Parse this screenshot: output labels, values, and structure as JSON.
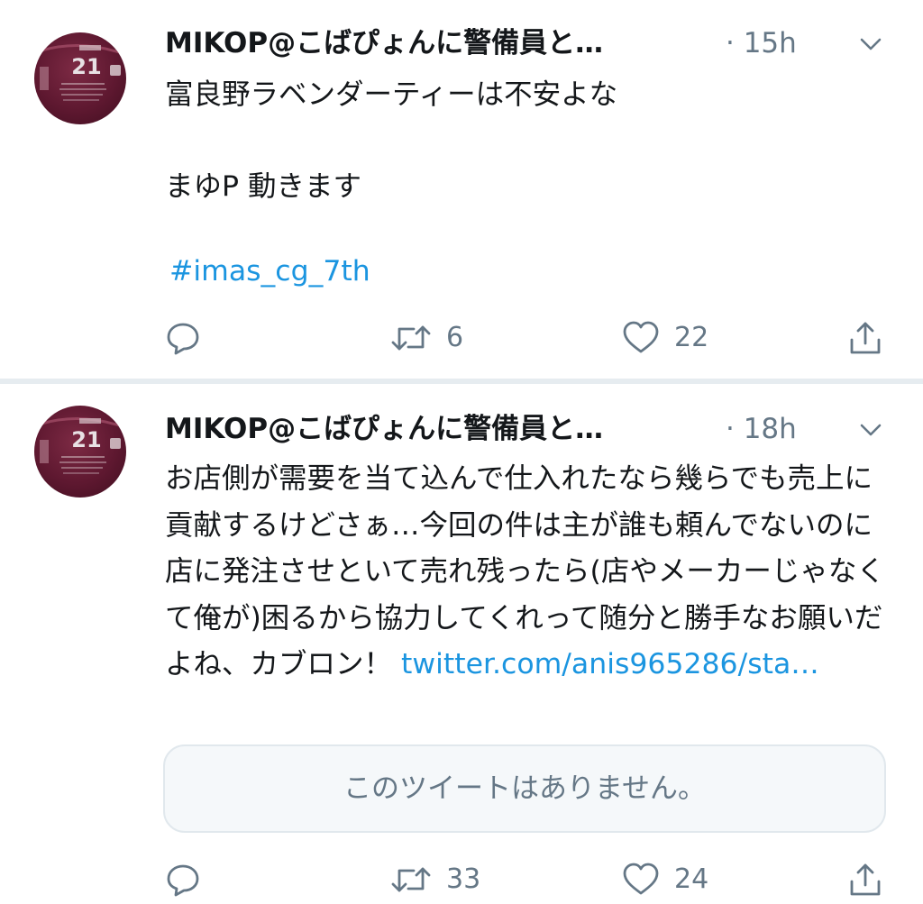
{
  "tweets": [
    {
      "author": "MIKOP@こばぴょんに警備員と…",
      "time": "· 15h",
      "avatar_number": "21",
      "text": "富良野ラベンダーティーは不安よな\n\nまゆP 動きます",
      "hashtag": "#imas_cg_7th",
      "retweets": "6",
      "likes": "22"
    },
    {
      "author": "MIKOP@こばぴょんに警備員と…",
      "time": "· 18h",
      "avatar_number": "21",
      "text": "お店側が需要を当て込んで仕入れたなら幾らでも売上に貢献するけどさぁ…今回の件は主が誰も頼んでないのに店に発注させといて売れ残ったら(店やメーカーじゃなくて俺が)困るから協力してくれって随分と勝手なお願いだよね、カブロン！ ",
      "link": "twitter.com/anis965286/sta…",
      "quoted_unavailable": "このツイートはありません。",
      "retweets": "33",
      "likes": "24"
    }
  ],
  "icons": {
    "reply": "reply-icon",
    "retweet": "retweet-icon",
    "like": "heart-icon",
    "share": "share-icon",
    "more": "chevron-down-icon"
  },
  "colors": {
    "link": "#1b95e0",
    "secondary_text": "#657786",
    "divider": "#e6ecf0"
  }
}
